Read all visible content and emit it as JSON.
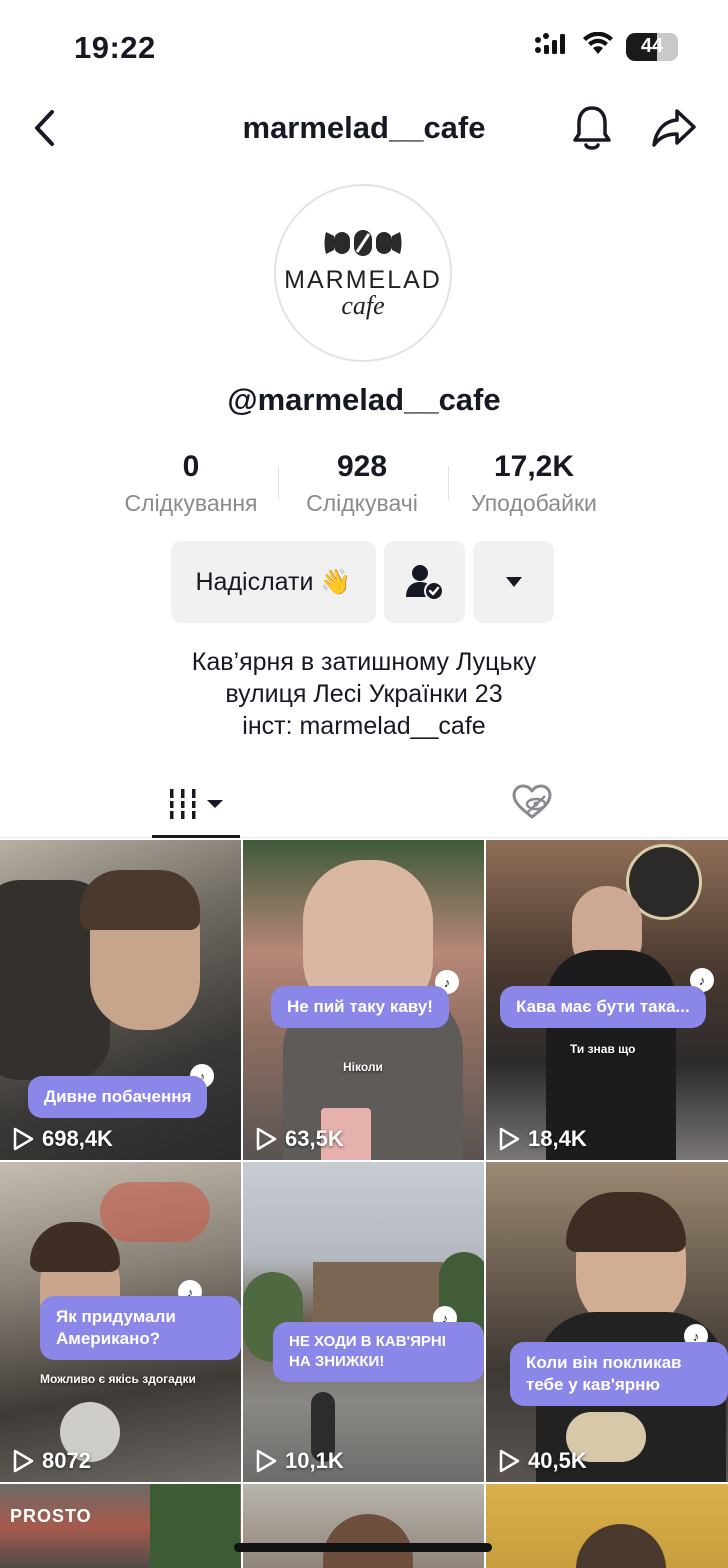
{
  "status_bar": {
    "time": "19:22",
    "battery": "44"
  },
  "header": {
    "title": "marmelad__cafe"
  },
  "avatar": {
    "logo_word": "MARMELAD",
    "logo_sub": "cafe"
  },
  "profile": {
    "username": "@marmelad__cafe"
  },
  "stats": [
    {
      "value": "0",
      "label": "Слідкування"
    },
    {
      "value": "928",
      "label": "Слідкувачі"
    },
    {
      "value": "17,2K",
      "label": "Уподобайки"
    }
  ],
  "actions": {
    "send_label": "Надіслати 👋"
  },
  "bio": {
    "line1": "Кав’ярня в затишному Луцьку",
    "line2": "вулиця Лесі Українки 23",
    "line3": "інст: marmelad__cafe"
  },
  "videos": [
    {
      "caption": "Дивне побачення",
      "subtext": "",
      "views": "698,4K"
    },
    {
      "caption": "Не пий таку каву!",
      "subtext": "Ніколи",
      "views": "63,5K"
    },
    {
      "caption": "Кава має бути така...",
      "subtext": "Ти знав що",
      "views": "18,4K"
    },
    {
      "caption": "Як придумали Американо?",
      "subtext": "Можливо є якісь здогадки",
      "views": "8072"
    },
    {
      "caption": "НЕ ХОДИ В КАВ'ЯРНІ НА ЗНИЖКИ!",
      "subtext": "",
      "views": "10,1K"
    },
    {
      "caption": "Коли він покликав тебе у кав'ярню",
      "subtext": "",
      "views": "40,5K"
    },
    {
      "sign": "PROSTO"
    }
  ],
  "colors": {
    "accent_bubble": "#8b87e8",
    "button_bg": "#f1f1f2",
    "secondary_text": "#8a8b91"
  }
}
